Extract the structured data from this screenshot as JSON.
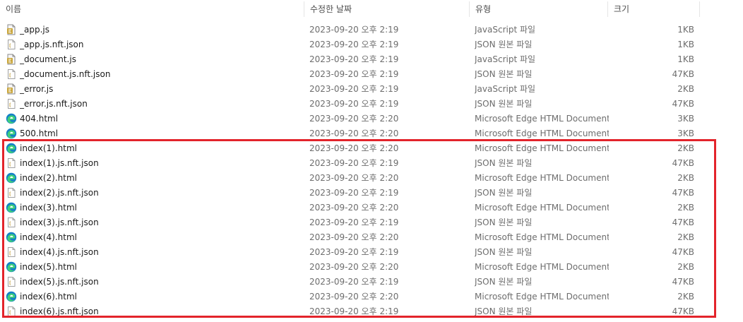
{
  "columns": {
    "name": "이름",
    "date": "수정한 날짜",
    "type": "유형",
    "size": "크기"
  },
  "sort_indicator": "^",
  "highlight_color": "#e3242b",
  "files": [
    {
      "name": "_app.js",
      "date": "2023-09-20 오후 2:19",
      "type": "JavaScript 파일",
      "size": "1KB",
      "icon": "javascript-file-icon"
    },
    {
      "name": "_app.js.nft.json",
      "date": "2023-09-20 오후 2:19",
      "type": "JSON 원본 파일",
      "size": "1KB",
      "icon": "json-file-icon"
    },
    {
      "name": "_document.js",
      "date": "2023-09-20 오후 2:19",
      "type": "JavaScript 파일",
      "size": "1KB",
      "icon": "javascript-file-icon"
    },
    {
      "name": "_document.js.nft.json",
      "date": "2023-09-20 오후 2:19",
      "type": "JSON 원본 파일",
      "size": "47KB",
      "icon": "json-file-icon"
    },
    {
      "name": "_error.js",
      "date": "2023-09-20 오후 2:19",
      "type": "JavaScript 파일",
      "size": "2KB",
      "icon": "javascript-file-icon"
    },
    {
      "name": "_error.js.nft.json",
      "date": "2023-09-20 오후 2:19",
      "type": "JSON 원본 파일",
      "size": "47KB",
      "icon": "json-file-icon"
    },
    {
      "name": "404.html",
      "date": "2023-09-20 오후 2:20",
      "type": "Microsoft Edge HTML Document",
      "size": "3KB",
      "icon": "edge-html-icon"
    },
    {
      "name": "500.html",
      "date": "2023-09-20 오후 2:20",
      "type": "Microsoft Edge HTML Document",
      "size": "3KB",
      "icon": "edge-html-icon"
    },
    {
      "name": "index(1).html",
      "date": "2023-09-20 오후 2:20",
      "type": "Microsoft Edge HTML Document",
      "size": "2KB",
      "icon": "edge-html-icon"
    },
    {
      "name": "index(1).js.nft.json",
      "date": "2023-09-20 오후 2:19",
      "type": "JSON 원본 파일",
      "size": "47KB",
      "icon": "json-file-icon"
    },
    {
      "name": "index(2).html",
      "date": "2023-09-20 오후 2:20",
      "type": "Microsoft Edge HTML Document",
      "size": "2KB",
      "icon": "edge-html-icon"
    },
    {
      "name": "index(2).js.nft.json",
      "date": "2023-09-20 오후 2:19",
      "type": "JSON 원본 파일",
      "size": "47KB",
      "icon": "json-file-icon"
    },
    {
      "name": "index(3).html",
      "date": "2023-09-20 오후 2:20",
      "type": "Microsoft Edge HTML Document",
      "size": "2KB",
      "icon": "edge-html-icon"
    },
    {
      "name": "index(3).js.nft.json",
      "date": "2023-09-20 오후 2:19",
      "type": "JSON 원본 파일",
      "size": "47KB",
      "icon": "json-file-icon"
    },
    {
      "name": "index(4).html",
      "date": "2023-09-20 오후 2:20",
      "type": "Microsoft Edge HTML Document",
      "size": "2KB",
      "icon": "edge-html-icon"
    },
    {
      "name": "index(4).js.nft.json",
      "date": "2023-09-20 오후 2:19",
      "type": "JSON 원본 파일",
      "size": "47KB",
      "icon": "json-file-icon"
    },
    {
      "name": "index(5).html",
      "date": "2023-09-20 오후 2:20",
      "type": "Microsoft Edge HTML Document",
      "size": "2KB",
      "icon": "edge-html-icon"
    },
    {
      "name": "index(5).js.nft.json",
      "date": "2023-09-20 오후 2:19",
      "type": "JSON 원본 파일",
      "size": "47KB",
      "icon": "json-file-icon"
    },
    {
      "name": "index(6).html",
      "date": "2023-09-20 오후 2:20",
      "type": "Microsoft Edge HTML Document",
      "size": "2KB",
      "icon": "edge-html-icon"
    },
    {
      "name": "index(6).js.nft.json",
      "date": "2023-09-20 오후 2:19",
      "type": "JSON 원본 파일",
      "size": "47KB",
      "icon": "json-file-icon"
    }
  ]
}
